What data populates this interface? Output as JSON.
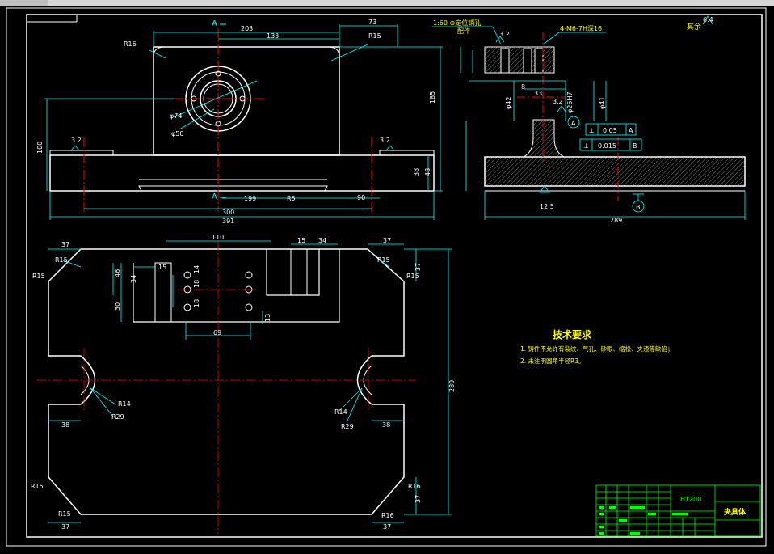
{
  "colors": {
    "background": "#000000",
    "outline": "#ffffff",
    "dimension": "#00ffff",
    "centerline": "#ff0000",
    "hatch": "#808080",
    "title_block": "#00ff00",
    "notes": "#ffff00",
    "small_text": "#ffffff"
  },
  "front_view": {
    "section_top": "A",
    "section_bottom": "A",
    "dims": {
      "d203": "203",
      "d73": "73",
      "d133": "133",
      "r15": "R15",
      "r16": "R16",
      "d185": "185",
      "d100": "100",
      "d38": "38",
      "d48": "48",
      "phi74": "φ74",
      "phi50": "φ50",
      "d199": "199",
      "r5": "R5",
      "d90": "90",
      "d300": "300",
      "d391": "391",
      "rough_l": "3.2",
      "rough_r": "3.2"
    }
  },
  "side_view": {
    "scale_note": "1:60 ⊕定位销孔",
    "scale_note2": "配作",
    "bolt_note": "4-M6-7H深16",
    "rough_top": "3.2",
    "rough_mid": "3.2",
    "dims": {
      "d8": "8",
      "d33": "33",
      "phi42": "φ42",
      "phi25": "φ25H7",
      "phi41": "φ41",
      "tol1_a": "⊥",
      "tol1_b": "0.05",
      "tol1_c": "A",
      "tol2_a": "⊥",
      "tol2_b": "0.015",
      "tol2_c": "B",
      "datum_a": "A",
      "datum_b": "B",
      "rough_bottom": "12.5",
      "d289": "289"
    }
  },
  "corner_note": "其余",
  "corner_rough": "6.4",
  "top_view": {
    "dims": {
      "d37tl": "37",
      "r15a": "R15",
      "r15b": "R15",
      "d110": "110",
      "d15a": "15",
      "d34a": "34",
      "d37tr": "37",
      "r15c": "R15",
      "r15d": "R15",
      "d37r": "37",
      "d46": "46",
      "d34": "34",
      "d30": "30",
      "d15b": "15",
      "d18": "18",
      "d14": "14",
      "d18b": "18",
      "d13": "13",
      "d69": "69",
      "r14a": "R14",
      "r29a": "R29",
      "d38a": "38",
      "r14b": "R14",
      "r29b": "R29",
      "d38b": "38",
      "d289": "289",
      "r15e": "R15",
      "r15f": "R15",
      "r16": "R16",
      "d37bl": "37",
      "r16b": "R16",
      "d37br": "37",
      "d37rb": "37"
    }
  },
  "tech_req": {
    "title": "技术要求",
    "line1": "1. 铸件不允许有裂纹、气孔、砂眼、缩松、夹渣等缺陷；",
    "line2": "2. 未注明圆角半径R3。"
  },
  "title_block": {
    "material": "HT200",
    "name": "夹具体"
  }
}
